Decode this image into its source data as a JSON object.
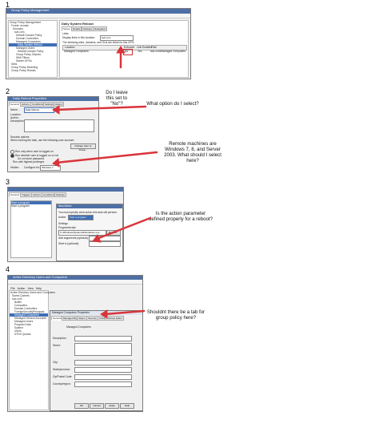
{
  "steps": [
    "1",
    "2",
    "3",
    "4"
  ],
  "shot1": {
    "title": "Group Policy Management",
    "menu": [
      "File",
      "Action",
      "View",
      "Window",
      "Help"
    ],
    "tree": [
      "Group Policy Management",
      "Forest: domain",
      "Domains",
      "sub.com",
      "Default Domain Policy",
      "Domain Controllers",
      "Managed Computers",
      "Daily System Reboot",
      "Managed Users",
      "Default Domain Policy",
      "Group Policy Objects",
      "WMI Filters",
      "Starter GPOs",
      "Sites",
      "Group Policy Modeling",
      "Group Policy Results"
    ],
    "panel_title": "Daily System Reboot",
    "tabs": [
      "Scope",
      "Details",
      "Settings",
      "Delegation"
    ],
    "links_label": "Links",
    "display_label": "Display links in this location:",
    "location_value": "sub.com",
    "links_hint": "The following sites, domains, and OUs are linked to this GPO:",
    "columns": [
      "Location",
      "Enforced",
      "Link Enabled",
      "Path"
    ],
    "row": [
      "Managed Computers",
      "No",
      "Yes",
      "sub.com/Managed Computers"
    ]
  },
  "shot2": {
    "title": "Daily Reboot Properties",
    "tabs": [
      "General",
      "Actions",
      "Conditions",
      "Settings",
      "History"
    ],
    "name_label": "Name:",
    "name_value": "Daily Reboot",
    "location_label": "Location:",
    "author_label": "Author:",
    "description_label": "Description:",
    "security_label": "Security options",
    "user_label": "When running the task, use the following user account:",
    "user_button": "Change User or Group...",
    "options": [
      "Run only when user is logged on",
      "Run whether user is logged on or not",
      "Do not store password.",
      "Run with highest privileges"
    ],
    "hidden_label": "Hidden",
    "configure_label": "Configure for:",
    "configure_value": "Windows 7"
  },
  "shot3": {
    "title": "New Action",
    "tabs": [
      "General",
      "Triggers",
      "Actions",
      "Conditions",
      "Settings"
    ],
    "hint": "You must specify what action this task will perform.",
    "action_label": "Action:",
    "action_value": "Start a program",
    "settings_label": "Settings",
    "program_label": "Program/script:",
    "program_value": "C:\\Windows\\System32\\shutdown.exe",
    "browse_label": "Browse...",
    "args_label": "Add arguments (optional):",
    "start_label": "Start in (optional):",
    "list_items": [
      "Start a program",
      "Start a program"
    ]
  },
  "shot4": {
    "title": "Active Directory Users and Computers",
    "menu": [
      "File",
      "Action",
      "View",
      "Help"
    ],
    "tree": [
      "Active Directory Users and Computers",
      "Saved Queries",
      "sub.com",
      "Builtin",
      "Computers",
      "Domain Controllers",
      "ForeignSecurityPrincipals",
      "Managed Computers",
      "Managed Service Accounts",
      "Managed Users",
      "Program Data",
      "System",
      "Users",
      "NTDS Quotas"
    ],
    "dialog_title": "Managed Computers Properties",
    "tabs": [
      "General",
      "Managed By",
      "Object",
      "Security",
      "COM+",
      "Attribute Editor"
    ],
    "object_name": "Managed Computers",
    "fields": [
      "Description:",
      "Street:",
      "City:",
      "State/province:",
      "Zip/Postal Code:",
      "Country/region:"
    ],
    "buttons": [
      "OK",
      "Cancel",
      "Apply",
      "Help"
    ]
  },
  "notes": {
    "n1": "Do I leave this set to \"No\"?",
    "n2": "What option do I select?",
    "n3": "Remote machines are Windows 7, 8, and Server 2003. What should I select here?",
    "n4": "Is the action parameter defined properly for a reboot?",
    "n5": "Shouldnt there be a tab for group policy here?"
  },
  "colors": {
    "titlebar": "#4d6fa6",
    "arrow": "#d9343a",
    "highlight": "#3f6fb5"
  }
}
